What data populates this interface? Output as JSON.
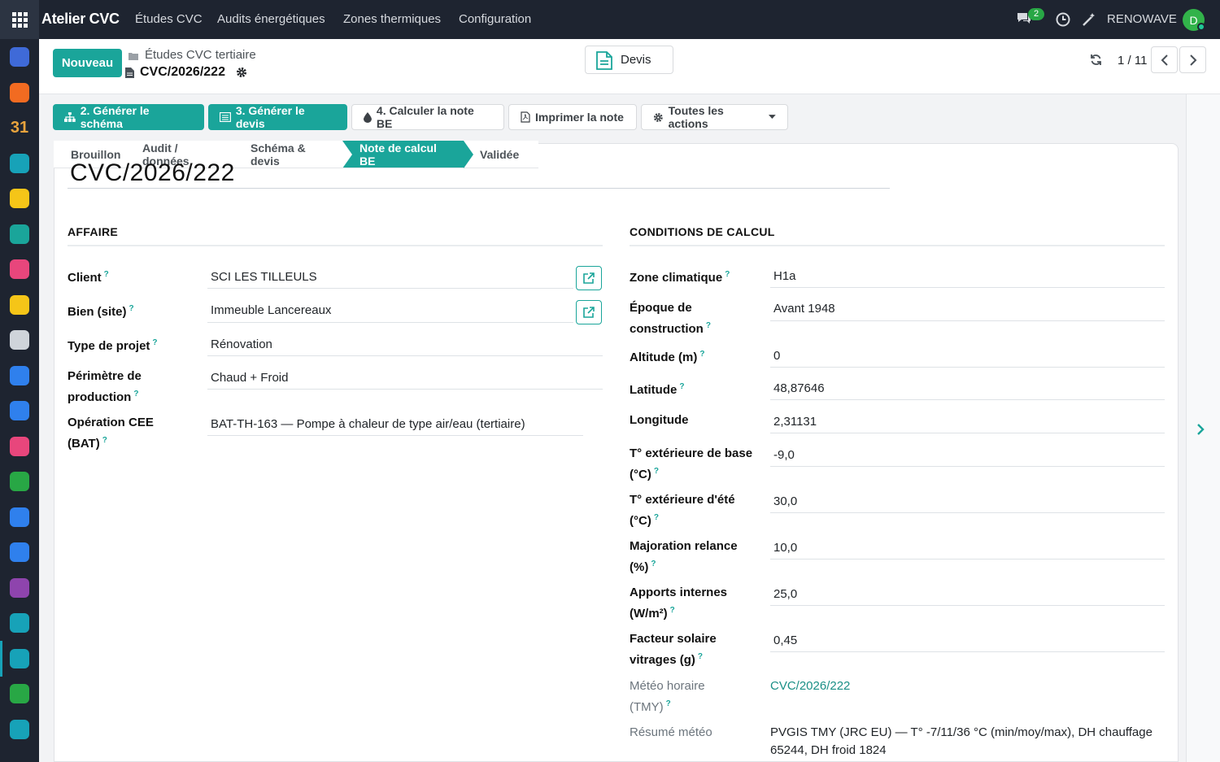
{
  "navbar": {
    "brand": "Atelier CVC",
    "menus": [
      "Études CVC",
      "Audits énergétiques",
      "Zones thermiques",
      "Configuration"
    ],
    "chat_count": "2",
    "company": "RENOWAVE",
    "avatar_initial": "D"
  },
  "dock": {
    "apps": [
      {
        "icon": "discuss-icon",
        "color": "#3f6ad8"
      },
      {
        "icon": "chat-bubble-icon",
        "color": "#f26b21"
      },
      {
        "icon": "calendar-31-icon",
        "color": "#e8a33d",
        "label": "31"
      },
      {
        "icon": "sign-icon",
        "color": "#17a2b8"
      },
      {
        "icon": "disc-icon",
        "color": "#f5c518"
      },
      {
        "icon": "contacts-icon",
        "color": "#1aa59a"
      },
      {
        "icon": "crm-icon",
        "color": "#e8467c"
      },
      {
        "icon": "disc-icon",
        "color": "#f5c518"
      },
      {
        "icon": "building-icon",
        "color": "#cfd4da"
      },
      {
        "icon": "square-app-icon",
        "color": "#2f80ed"
      },
      {
        "icon": "calendar-icon",
        "color": "#2f80ed"
      },
      {
        "icon": "dashboard-icon",
        "color": "#e8467c"
      },
      {
        "icon": "inventory-icon",
        "color": "#28a745"
      },
      {
        "icon": "calendar-icon",
        "color": "#2f80ed"
      },
      {
        "icon": "square-app-icon",
        "color": "#2f80ed"
      },
      {
        "icon": "purple-app-icon",
        "color": "#8e44ad"
      },
      {
        "icon": "document-app-icon",
        "color": "#17a2b8"
      },
      {
        "icon": "cvc-app-icon",
        "color": "#17a2b8"
      },
      {
        "icon": "spreadsheet-icon",
        "color": "#28a745"
      },
      {
        "icon": "check-app-icon",
        "color": "#17a2b8"
      }
    ]
  },
  "control": {
    "new_label": "Nouveau",
    "breadcrumb_parent": "Études CVC tertiaire",
    "breadcrumb_current": "CVC/2026/222",
    "devis_label": "Devis",
    "pager": "1 / 11"
  },
  "actions": [
    {
      "label": "2. Générer le schéma",
      "icon": "sitemap-icon",
      "style": "primary"
    },
    {
      "label": "3. Générer le devis",
      "icon": "list-icon",
      "style": "primary"
    },
    {
      "label": "4. Calculer la note BE",
      "icon": "drop-icon",
      "style": "sec"
    },
    {
      "label": "Imprimer la note",
      "icon": "pdf-icon",
      "style": "sec"
    },
    {
      "label": "Toutes les actions",
      "icon": "gear-icon",
      "style": "sec"
    }
  ],
  "stages": [
    "Brouillon",
    "Audit / données",
    "Schéma & devis",
    "Note de calcul BE",
    "Validée"
  ],
  "active_stage": "Note de calcul BE",
  "record_title": "CVC/2026/222",
  "affaire": {
    "title": "AFFAIRE",
    "fields": [
      {
        "label": "Client",
        "value": "SCI LES TILLEULS"
      },
      {
        "label": "Bien (site)",
        "value": "Immeuble Lancereaux"
      },
      {
        "label": "Type de projet",
        "value": "Rénovation"
      },
      {
        "label": "Périmètre de production",
        "value": "Chaud + Froid"
      },
      {
        "label": "Opération CEE (BAT)",
        "value": "BAT-TH-163 — Pompe à chaleur de type air/eau (tertiaire)"
      }
    ]
  },
  "conditions": {
    "title": "CONDITIONS DE CALCUL",
    "fields": [
      {
        "label": "Zone climatique",
        "value": "H1a"
      },
      {
        "label": "Époque de construction",
        "value": "Avant 1948"
      },
      {
        "label": "Altitude (m)",
        "value": "0"
      },
      {
        "label": "Latitude",
        "value": "48,87646"
      },
      {
        "label": "Longitude",
        "value": "2,31131"
      },
      {
        "label": "T° extérieure de base (°C)",
        "value": "-9,0"
      },
      {
        "label": "T° extérieure d'été (°C)",
        "value": "30,0"
      },
      {
        "label": "Majoration relance (%)",
        "value": "10,0"
      },
      {
        "label": "Apports internes (W/m²)",
        "value": "25,0"
      },
      {
        "label": "Facteur solaire vitrages (g)",
        "value": "0,45"
      },
      {
        "label": "Météo horaire (TMY)",
        "value": "CVC/2026/222"
      },
      {
        "label": "Résumé météo",
        "value": "PVGIS TMY (JRC EU) — T° -7/11/36 °C (min/moy/max), DH chauffage 65244, DH froid 1824"
      }
    ]
  },
  "help_mark": "?",
  "accent_color": "#1aa59a"
}
